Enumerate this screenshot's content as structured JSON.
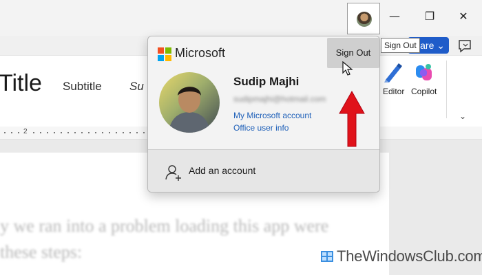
{
  "window": {
    "minimize_glyph": "—",
    "restore_glyph": "❐",
    "close_glyph": "✕"
  },
  "toolbar": {
    "share_label": "hare ⌄",
    "signout_tooltip": "Sign Out"
  },
  "ribbon": {
    "styles": [
      "Title",
      "Subtitle",
      "Su"
    ],
    "buttons": [
      {
        "label": "Editor",
        "icon": "editor-icon"
      },
      {
        "label": "Copilot",
        "icon": "copilot-icon"
      }
    ],
    "expand_glyph": "⌄"
  },
  "ruler": {
    "numbers": [
      "2"
    ]
  },
  "document": {
    "lines": [
      "y we ran into a problem loading this app were",
      "these steps:"
    ]
  },
  "account_flyout": {
    "brand": "Microsoft",
    "sign_out_label": "Sign Out",
    "user_name": "Sudip Majhi",
    "user_email": "sudipmajhi@hotmail.com",
    "links": [
      "My Microsoft account",
      "Office user info"
    ],
    "add_account_label": "Add an account"
  },
  "watermark": {
    "text": "TheWindowsClub.com"
  },
  "colors": {
    "accent_blue": "#1f5cc9",
    "link_blue": "#1d5fb8",
    "arrow_red": "#e0121a",
    "ms_red": "#f25022",
    "ms_green": "#7fba00",
    "ms_blue": "#00a4ef",
    "ms_yellow": "#ffb900"
  }
}
